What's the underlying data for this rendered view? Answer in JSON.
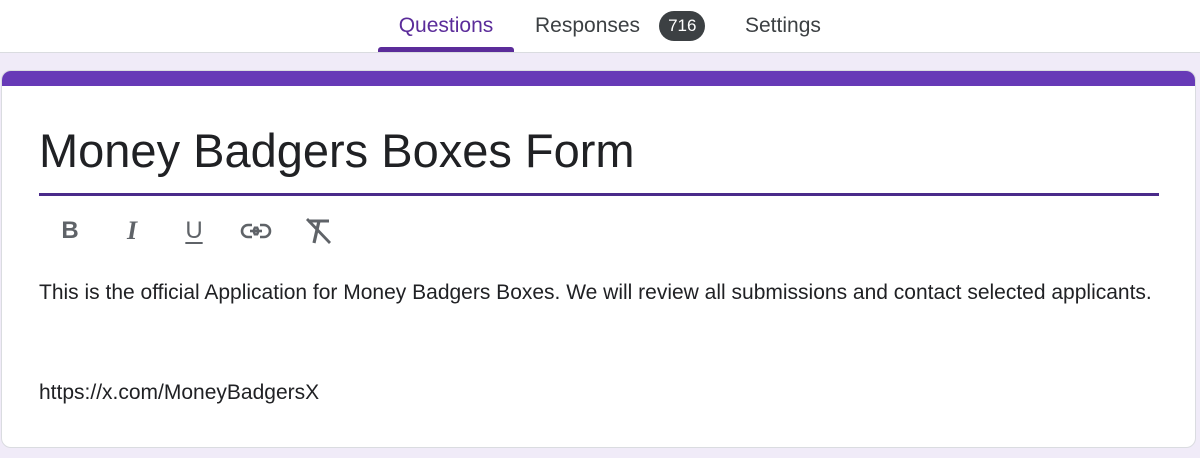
{
  "tabs": {
    "questions": "Questions",
    "responses": "Responses",
    "responses_count": "716",
    "settings": "Settings"
  },
  "form": {
    "title": "Money Badgers Boxes Form",
    "description": "This is the official Application for Money Badgers Boxes. We will review all submissions and contact selected applicants.",
    "link": "https://x.com/MoneyBadgersX"
  },
  "toolbar": {
    "bold_glyph": "B",
    "italic_glyph": "I",
    "underline_glyph": "U",
    "icons": [
      "bold-icon",
      "italic-icon",
      "underline-icon",
      "link-icon",
      "clear-formatting-icon"
    ]
  },
  "colors": {
    "accent": "#673ab7",
    "active_tab": "#5b2c9a",
    "background": "#f0ebf8",
    "badge": "#3c4043"
  }
}
